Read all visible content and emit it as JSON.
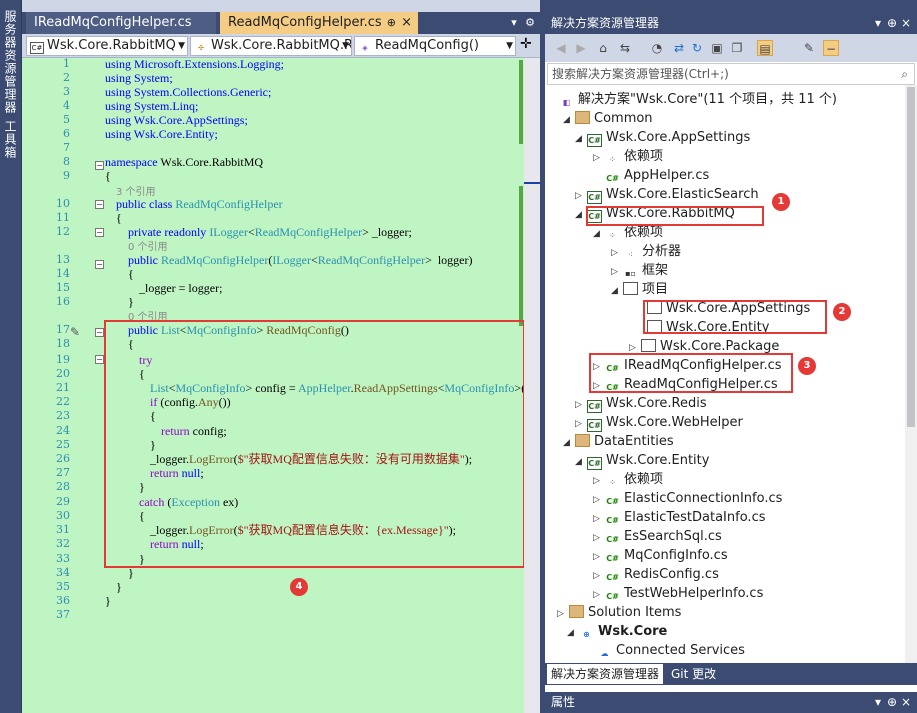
{
  "sidebar": {
    "server_explorer": "服务器资源管理器",
    "toolbox": "工具箱"
  },
  "doc_tabs": [
    {
      "label": "IReadMqConfigHelper.cs"
    },
    {
      "label": "ReadMqConfigHelper.cs",
      "pin": "⊕",
      "close": "×"
    }
  ],
  "nav": {
    "project": "Wsk.Core.RabbitMQ",
    "class": "Wsk.Core.RabbitMQ.R",
    "member": "ReadMqConfig()"
  },
  "code": {
    "lines": [
      "1",
      "2",
      "3",
      "4",
      "5",
      "6",
      "7",
      "8",
      "9",
      "10",
      "11",
      "12",
      "13",
      "14",
      "15",
      "16",
      "17",
      "18",
      "19",
      "20",
      "21",
      "22",
      "23",
      "24",
      "25",
      "26",
      "27",
      "28",
      "29",
      "30",
      "31",
      "32",
      "33",
      "34",
      "35",
      "36",
      "37"
    ],
    "refs": [
      "3 个引用",
      "0 个引用",
      "0 个引用"
    ],
    "l1": "using Microsoft.Extensions.Logging;",
    "l2": "using System;",
    "l3": "using System.Collections.Generic;",
    "l4": "using System.Linq;",
    "l5": "using Wsk.Core.AppSettings;",
    "l6": "using Wsk.Core.Entity;",
    "l8a": "namespace",
    "l8b": " Wsk.Core.RabbitMQ",
    "l9": "{",
    "l10a": "public class",
    "l10b": "ReadMqConfigHelper",
    "l11": "{",
    "l12a": "private readonly",
    "l12b": "ILogger",
    "l12c": "ReadMqConfigHelper",
    "l12d": "> _logger;",
    "l13a": "public",
    "l13b": "ReadMqConfigHelper",
    "l13c": "ILogger",
    "l13d": "ReadMqConfigHelper",
    "l13e": ">  logger)",
    "l14": "{",
    "l15": "_logger = logger;",
    "l16": "}",
    "l17a": "public",
    "l17b": "List",
    "l17c": "MqConfigInfo",
    "l17d": "ReadMqConfig",
    "l18": "{",
    "l19": "try",
    "l20": "{",
    "l21a": "List",
    "l21b": "MqConfigInfo",
    "l21c": "> config = ",
    "l21d": "AppHelper",
    "l21e": "ReadAppSettings",
    "l21f": "MqConfigInfo",
    "l22a": "if",
    "l22b": " (config.",
    "l22c": "Any",
    "l22d": "())",
    "l23": "{",
    "l24a": "return",
    "l24b": " config;",
    "l25": "}",
    "l26a": "_logger.",
    "l26b": "LogError",
    "l26c": "$\"获取MQ配置信息失败：没有可用数据集\"",
    "l27a": "return",
    "l27b": "null",
    "l28": "}",
    "l29a": "catch",
    "l29b": "Exception",
    "l29c": " ex)",
    "l30": "{",
    "l31a": "_logger.",
    "l31b": "LogError",
    "l31c": "$\"获取MQ配置信息失败：{ex.Message}\"",
    "l32a": "return",
    "l32b": "null",
    "l33": "}",
    "l34": "}",
    "l35": "}",
    "l36": "}"
  },
  "badges": [
    "1",
    "2",
    "3",
    "4"
  ],
  "solution_explorer": {
    "title": "解决方案资源管理器",
    "search_placeholder": "搜索解决方案资源管理器(Ctrl+;)",
    "tree": [
      "解决方案\"Wsk.Core\"(11 个项目，共 11 个)",
      "Common",
      "Wsk.Core.AppSettings",
      "依赖项",
      "AppHelper.cs",
      "Wsk.Core.ElasticSearch",
      "Wsk.Core.RabbitMQ",
      "依赖项",
      "分析器",
      "框架",
      "项目",
      "Wsk.Core.AppSettings",
      "Wsk.Core.Entity",
      "Wsk.Core.Package",
      "IReadMqConfigHelper.cs",
      "ReadMqConfigHelper.cs",
      "Wsk.Core.Redis",
      "Wsk.Core.WebHelper",
      "DataEntities",
      "Wsk.Core.Entity",
      "依赖项",
      "ElasticConnectionInfo.cs",
      "ElasticTestDataInfo.cs",
      "EsSearchSql.cs",
      "MqConfigInfo.cs",
      "RedisConfig.cs",
      "TestWebHelperInfo.cs",
      "Solution Items",
      "Wsk.Core",
      "Connected Services"
    ],
    "bottom_tabs": [
      "解决方案资源管理器",
      "Git 更改"
    ],
    "properties_title": "属性"
  },
  "colors": {
    "accent": "#f5cc84",
    "frame": "#3b4b72",
    "code_bg": "#bff4c3",
    "highlight": "#e53935"
  }
}
